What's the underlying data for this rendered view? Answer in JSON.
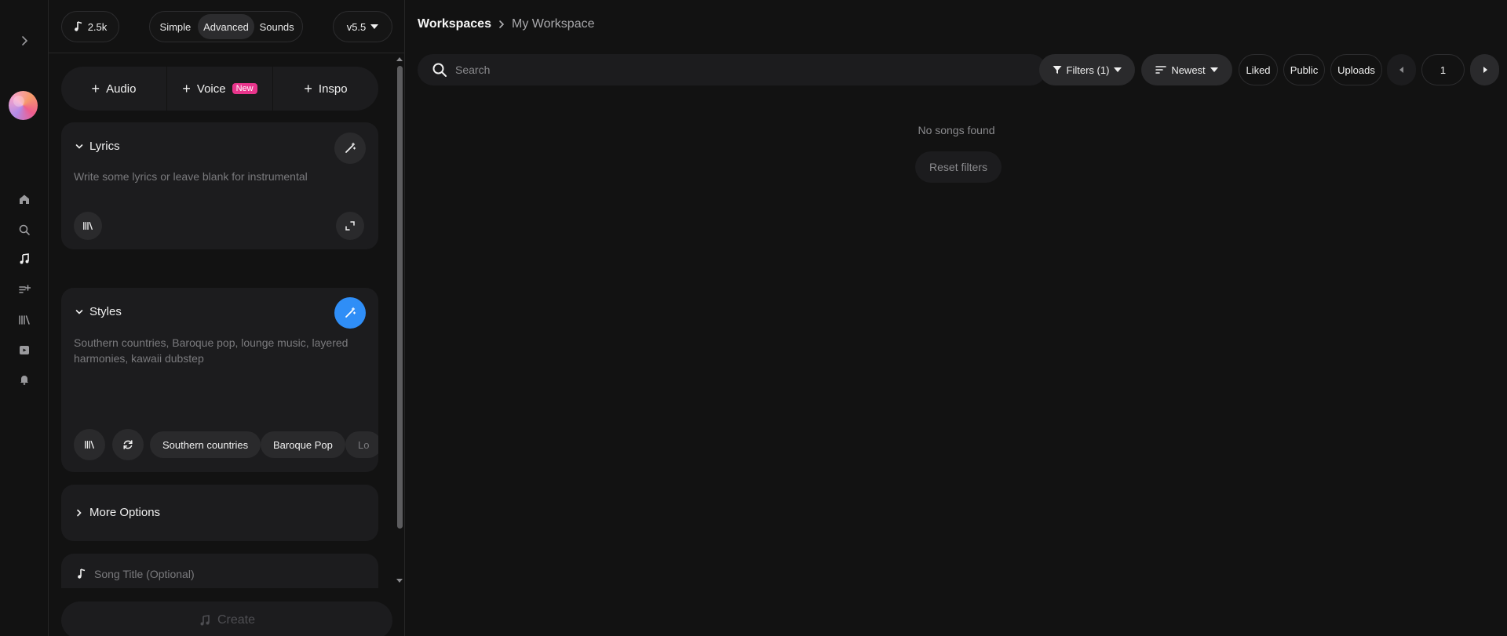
{
  "rail": {
    "expand_icon": "chevron-right-icon",
    "items": [
      {
        "name": "home",
        "icon": "home-icon"
      },
      {
        "name": "search",
        "icon": "search-icon"
      },
      {
        "name": "create",
        "icon": "music-note-icon"
      },
      {
        "name": "studio",
        "icon": "playlist-add-icon"
      },
      {
        "name": "library",
        "icon": "library-icon"
      },
      {
        "name": "hooks",
        "icon": "video-icon"
      },
      {
        "name": "notifications",
        "icon": "bell-icon"
      }
    ]
  },
  "panel": {
    "credits": "2.5k",
    "modes": [
      "Simple",
      "Advanced",
      "Sounds"
    ],
    "active_mode": "Advanced",
    "version": "v5.5",
    "add": {
      "audio": "Audio",
      "voice": "Voice",
      "voice_badge": "New",
      "inspo": "Inspo"
    },
    "lyrics": {
      "title": "Lyrics",
      "placeholder": "Write some lyrics or leave blank for instrumental"
    },
    "styles": {
      "title": "Styles",
      "placeholder_line1": "Southern countries, Baroque pop, lounge music, layered",
      "placeholder_line2": "harmonies, kawaii dubstep",
      "chips": [
        "Southern countries",
        "Baroque Pop",
        "Lo"
      ]
    },
    "more_options": "More Options",
    "song_title_placeholder": "Song Title (Optional)",
    "create_label": "Create"
  },
  "main": {
    "breadcrumb": {
      "root": "Workspaces",
      "current": "My Workspace"
    },
    "search_placeholder": "Search",
    "toolbar": {
      "filters": "Filters (1)",
      "sort": "Newest",
      "liked": "Liked",
      "public": "Public",
      "uploads": "Uploads",
      "page": "1"
    },
    "empty_message": "No songs found",
    "reset_label": "Reset filters"
  },
  "colors": {
    "background": "#121212",
    "card": "#1c1c1e",
    "accent_blue": "#2f8ef7",
    "badge_pink": "#e8358c"
  }
}
